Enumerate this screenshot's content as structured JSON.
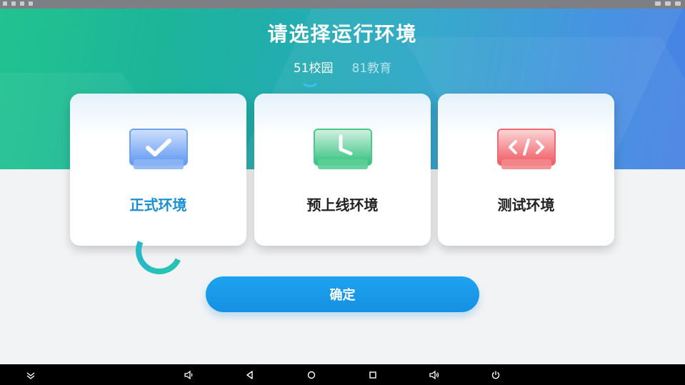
{
  "page": {
    "title": "请选择运行环境"
  },
  "env_tabs": [
    {
      "label": "51校园",
      "active": true
    },
    {
      "label": "81教育",
      "active": false
    }
  ],
  "cards": [
    {
      "label": "正式环境",
      "icon": "check-monitor-icon",
      "color": "#4f8ff0",
      "selected": true
    },
    {
      "label": "预上线环境",
      "icon": "clock-monitor-icon",
      "color": "#2fbf7d",
      "selected": false
    },
    {
      "label": "测试环境",
      "icon": "code-monitor-icon",
      "color": "#f0575f",
      "selected": false
    }
  ],
  "confirm_label": "确定",
  "colors": {
    "accent": "#1a8fd6",
    "button": "#1ea3ef",
    "hero_start": "#22c38f",
    "hero_end": "#4a82e4"
  },
  "nav_icons": [
    "collapse-icon",
    "volume-down-icon",
    "back-icon",
    "home-icon",
    "recents-icon",
    "volume-up-icon",
    "power-icon"
  ]
}
